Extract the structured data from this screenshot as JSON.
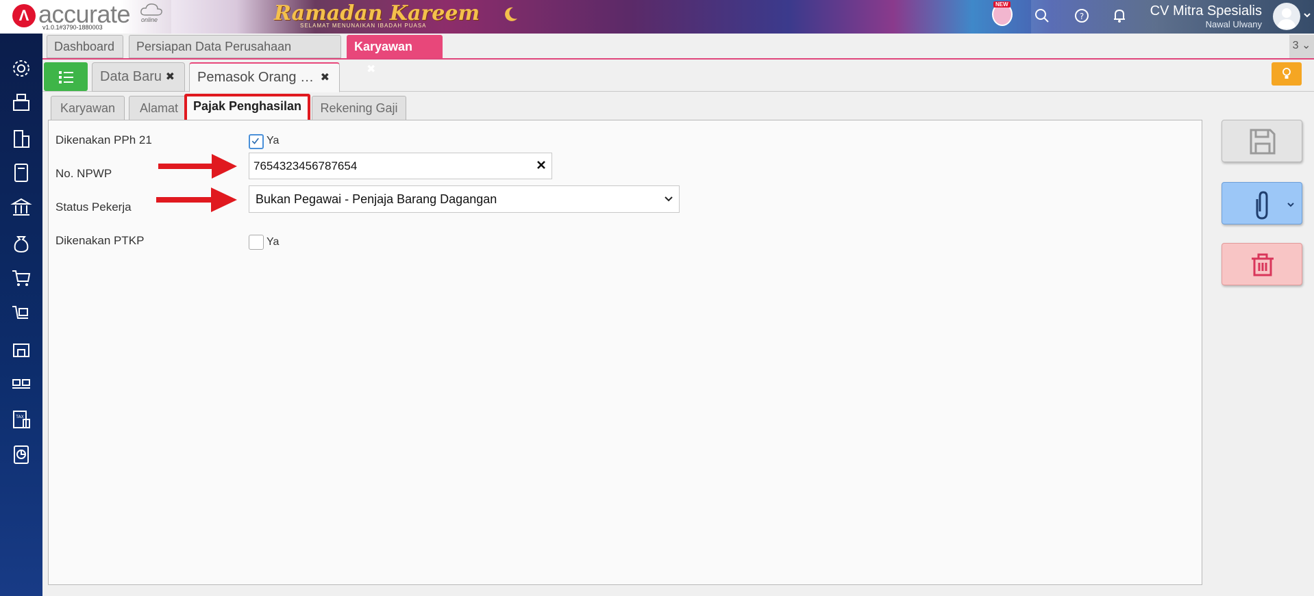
{
  "header": {
    "brand_name": "accurate",
    "brand_suffix": "online",
    "version": "v1.0.1#3790-1880003",
    "banner_title": "Ramadan Kareem",
    "banner_subtitle": "SELAMAT MENUNAIKAN IBADAH PUASA",
    "new_badge": "NEW",
    "company_name": "CV Mitra Spesialis",
    "user_name": "Nawal Ulwany"
  },
  "main_tabs": [
    {
      "label": "Dashboard"
    },
    {
      "label": "Persiapan Data Perusahaan"
    },
    {
      "label": "Karyawan",
      "close": "✖"
    }
  ],
  "tab_count": "3",
  "sub_tabs": [
    {
      "label": "Data Baru",
      "close": "✖"
    },
    {
      "label": "Pemasok Orang …",
      "close": "✖"
    }
  ],
  "form_tabs": [
    {
      "label": "Karyawan"
    },
    {
      "label": "Alamat"
    },
    {
      "label": "Pajak Penghasilan"
    },
    {
      "label": "Rekening Gaji"
    }
  ],
  "form": {
    "pph21_label": "Dikenakan PPh 21",
    "pph21_check_label": "Ya",
    "pph21_checked": true,
    "npwp_label": "No. NPWP",
    "npwp_value": "7654323456787654",
    "status_label": "Status Pekerja",
    "status_value": "Bukan Pegawai - Penjaja Barang Dagangan",
    "ptkp_label": "Dikenakan PTKP",
    "ptkp_check_label": "Ya",
    "ptkp_checked": false
  },
  "colors": {
    "accent_pink": "#e8477a",
    "sidebar_navy": "#0b1d4b",
    "green": "#3eb548",
    "annotation_red": "#e0191f"
  }
}
